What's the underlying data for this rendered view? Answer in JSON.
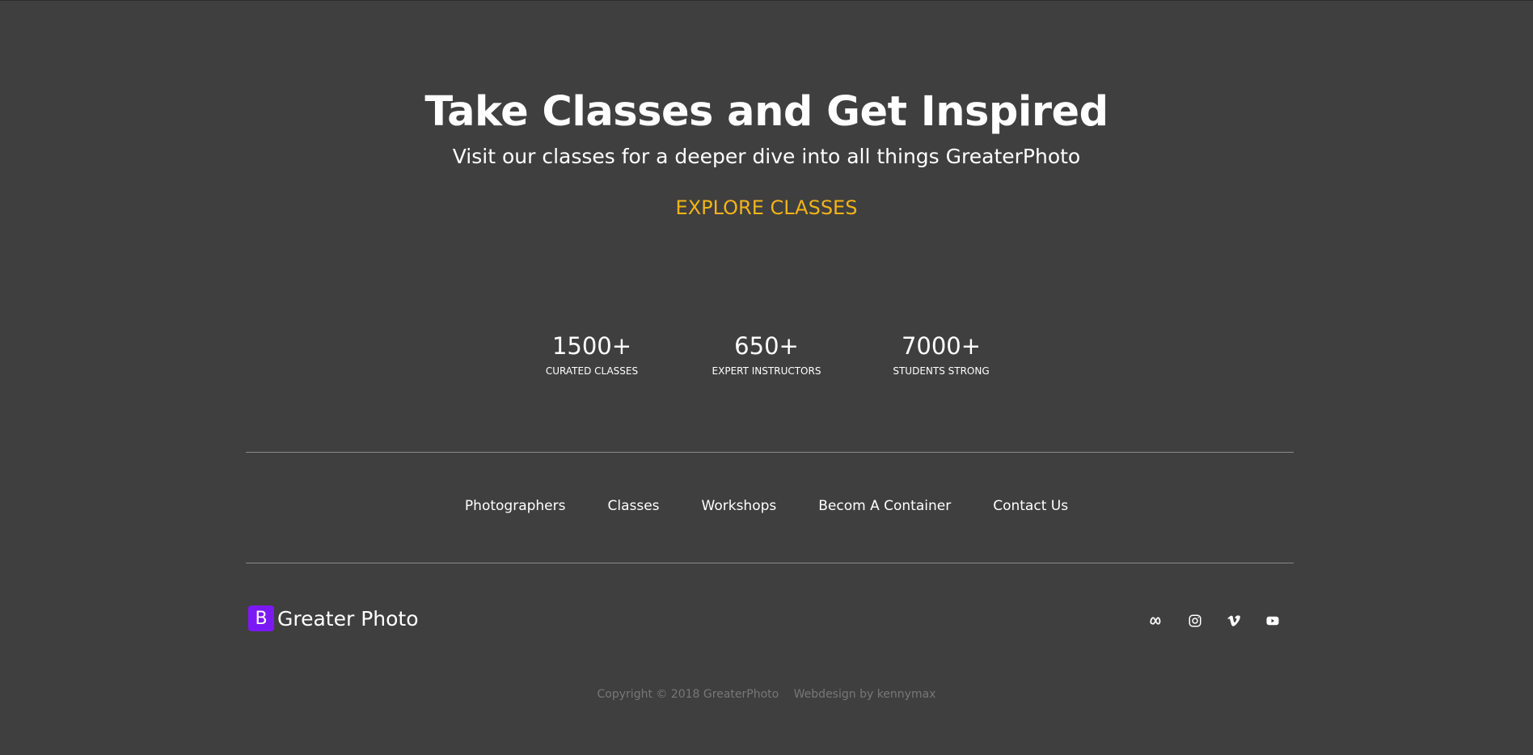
{
  "hero": {
    "title": "Take Classes and Get Inspired",
    "subtitle": "Visit our classes for a deeper dive into all things GreaterPhoto",
    "cta": "EXPLORE CLASSES"
  },
  "stats": [
    {
      "value": "1500+",
      "label": "CURATED CLASSES"
    },
    {
      "value": "650+",
      "label": "EXPERT INSTRUCTORS"
    },
    {
      "value": "7000+",
      "label": "STUDENTS STRONG"
    }
  ],
  "footer_nav": [
    {
      "label": "Photographers"
    },
    {
      "label": "Classes"
    },
    {
      "label": "Workshops"
    },
    {
      "label": "Becom A Container"
    },
    {
      "label": "Contact Us"
    }
  ],
  "brand": {
    "logo_letter": "B",
    "name": "Greater Photo"
  },
  "social": [
    {
      "icon": "meta-icon"
    },
    {
      "icon": "instagram-icon"
    },
    {
      "icon": "vimeo-icon"
    },
    {
      "icon": "youtube-icon"
    }
  ],
  "copyright": {
    "text": "Copyright © 2018 GreaterPhoto",
    "credit": "Webdesign by kennymax"
  },
  "colors": {
    "background": "#3f3f3f",
    "accent": "#f3b317",
    "brand": "#7b19f5",
    "muted": "#777777"
  }
}
